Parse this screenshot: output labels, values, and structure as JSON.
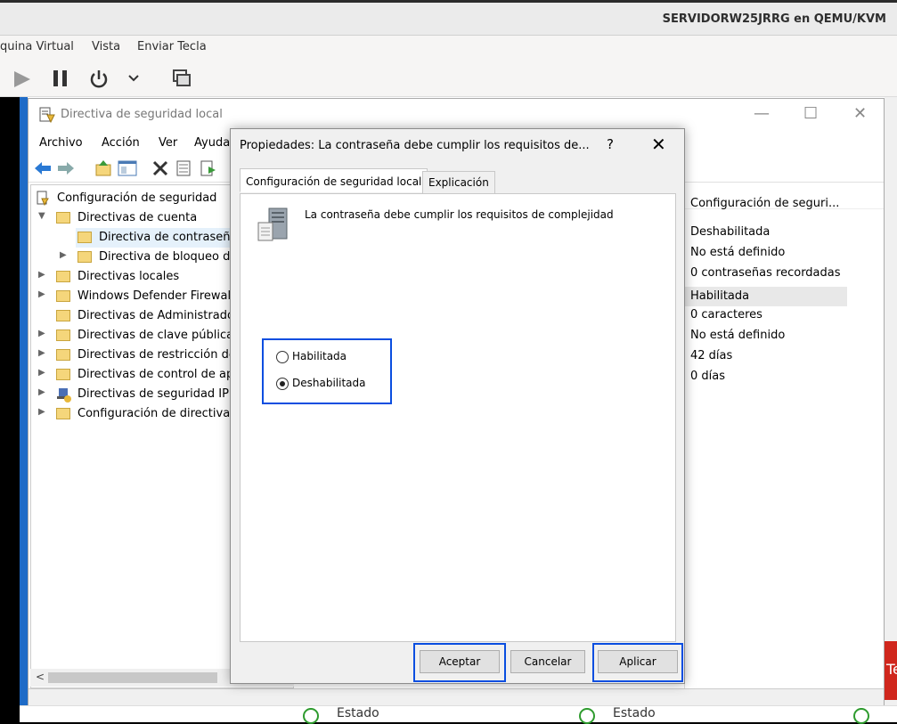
{
  "host": {
    "title": "SERVIDORW25JRRG en QEMU/KVM",
    "menu": [
      "quina Virtual",
      "Vista",
      "Enviar Tecla"
    ]
  },
  "mmc": {
    "title": "Directiva de seguridad local",
    "menu": [
      "Archivo",
      "Acción",
      "Ver",
      "Ayuda"
    ],
    "tree": [
      {
        "label": "Configuración de seguridad",
        "level": 0,
        "chev": ""
      },
      {
        "label": "Directivas de cuenta",
        "level": 1,
        "chev": "v"
      },
      {
        "label": "Directiva de contraseña",
        "level": 2,
        "chev": ""
      },
      {
        "label": "Directiva de bloqueo d",
        "level": 2,
        "chev": ">"
      },
      {
        "label": "Directivas locales",
        "level": 1,
        "chev": ">"
      },
      {
        "label": "Windows Defender Firewal",
        "level": 1,
        "chev": ">"
      },
      {
        "label": "Directivas de Administrado",
        "level": 1,
        "chev": ""
      },
      {
        "label": "Directivas de clave pública",
        "level": 1,
        "chev": ">"
      },
      {
        "label": "Directivas de restricción de",
        "level": 1,
        "chev": ">"
      },
      {
        "label": "Directivas de control de ap",
        "level": 1,
        "chev": ">"
      },
      {
        "label": "Directivas de seguridad IP",
        "level": 1,
        "chev": ">"
      },
      {
        "label": "Configuración de directiva",
        "level": 1,
        "chev": ">"
      }
    ],
    "right_header": "Configuración de seguri...",
    "values": [
      "Deshabilitada",
      "No está definido",
      "0 contraseñas recordadas",
      "Habilitada",
      "0 caracteres",
      "No está definido",
      "42 días",
      "0 días"
    ],
    "bottom_label": "Estado",
    "right_edge_label": "Te"
  },
  "dialog": {
    "title": "Propiedades: La contraseña debe cumplir los requisitos de...",
    "help": "?",
    "tabs": [
      "Configuración de seguridad local",
      "Explicación"
    ],
    "policy_desc": "La contraseña debe cumplir los requisitos de complejidad",
    "options": [
      "Habilitada",
      "Deshabilitada"
    ],
    "selected_option": "Deshabilitada",
    "buttons": {
      "ok": "Aceptar",
      "cancel": "Cancelar",
      "apply": "Aplicar"
    }
  }
}
